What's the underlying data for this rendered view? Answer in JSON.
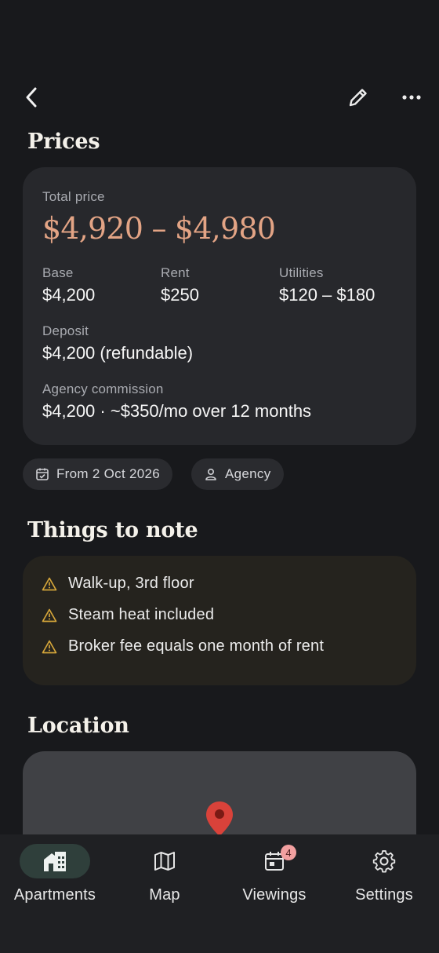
{
  "header": {
    "back_icon": "chevron-left-icon",
    "edit_icon": "pencil-icon",
    "more_icon": "more-horizontal-icon"
  },
  "prices": {
    "title": "Prices",
    "total_label": "Total price",
    "total_value": "$4,920 – $4,980",
    "base_label": "Base",
    "base_value": "$4,200",
    "rent_label": "Rent",
    "rent_value": "$250",
    "utilities_label": "Utilities",
    "utilities_value": "$120 – $180",
    "deposit_label": "Deposit",
    "deposit_value": "$4,200 (refundable)",
    "commission_label": "Agency commission",
    "commission_value": "$4,200 · ~$350/mo over 12 months",
    "accent_color": "#e3a485"
  },
  "chips": [
    {
      "icon": "calendar-check-icon",
      "label": "From 2 Oct 2026"
    },
    {
      "icon": "person-icon",
      "label": "Agency"
    }
  ],
  "notes": {
    "title": "Things to note",
    "items": [
      "Walk-up, 3rd floor",
      "Steam heat included",
      "Broker fee equals one month of rent"
    ],
    "icon": "warning-triangle-icon",
    "icon_color": "#d4a53a"
  },
  "location": {
    "title": "Location",
    "pin_icon": "map-pin-icon",
    "pin_color": "#d9423a"
  },
  "nav": [
    {
      "label": "Apartments",
      "icon": "building-icon",
      "active": true
    },
    {
      "label": "Map",
      "icon": "map-icon"
    },
    {
      "label": "Viewings",
      "icon": "calendar-icon",
      "badge": "4"
    },
    {
      "label": "Settings",
      "icon": "gear-icon"
    }
  ]
}
